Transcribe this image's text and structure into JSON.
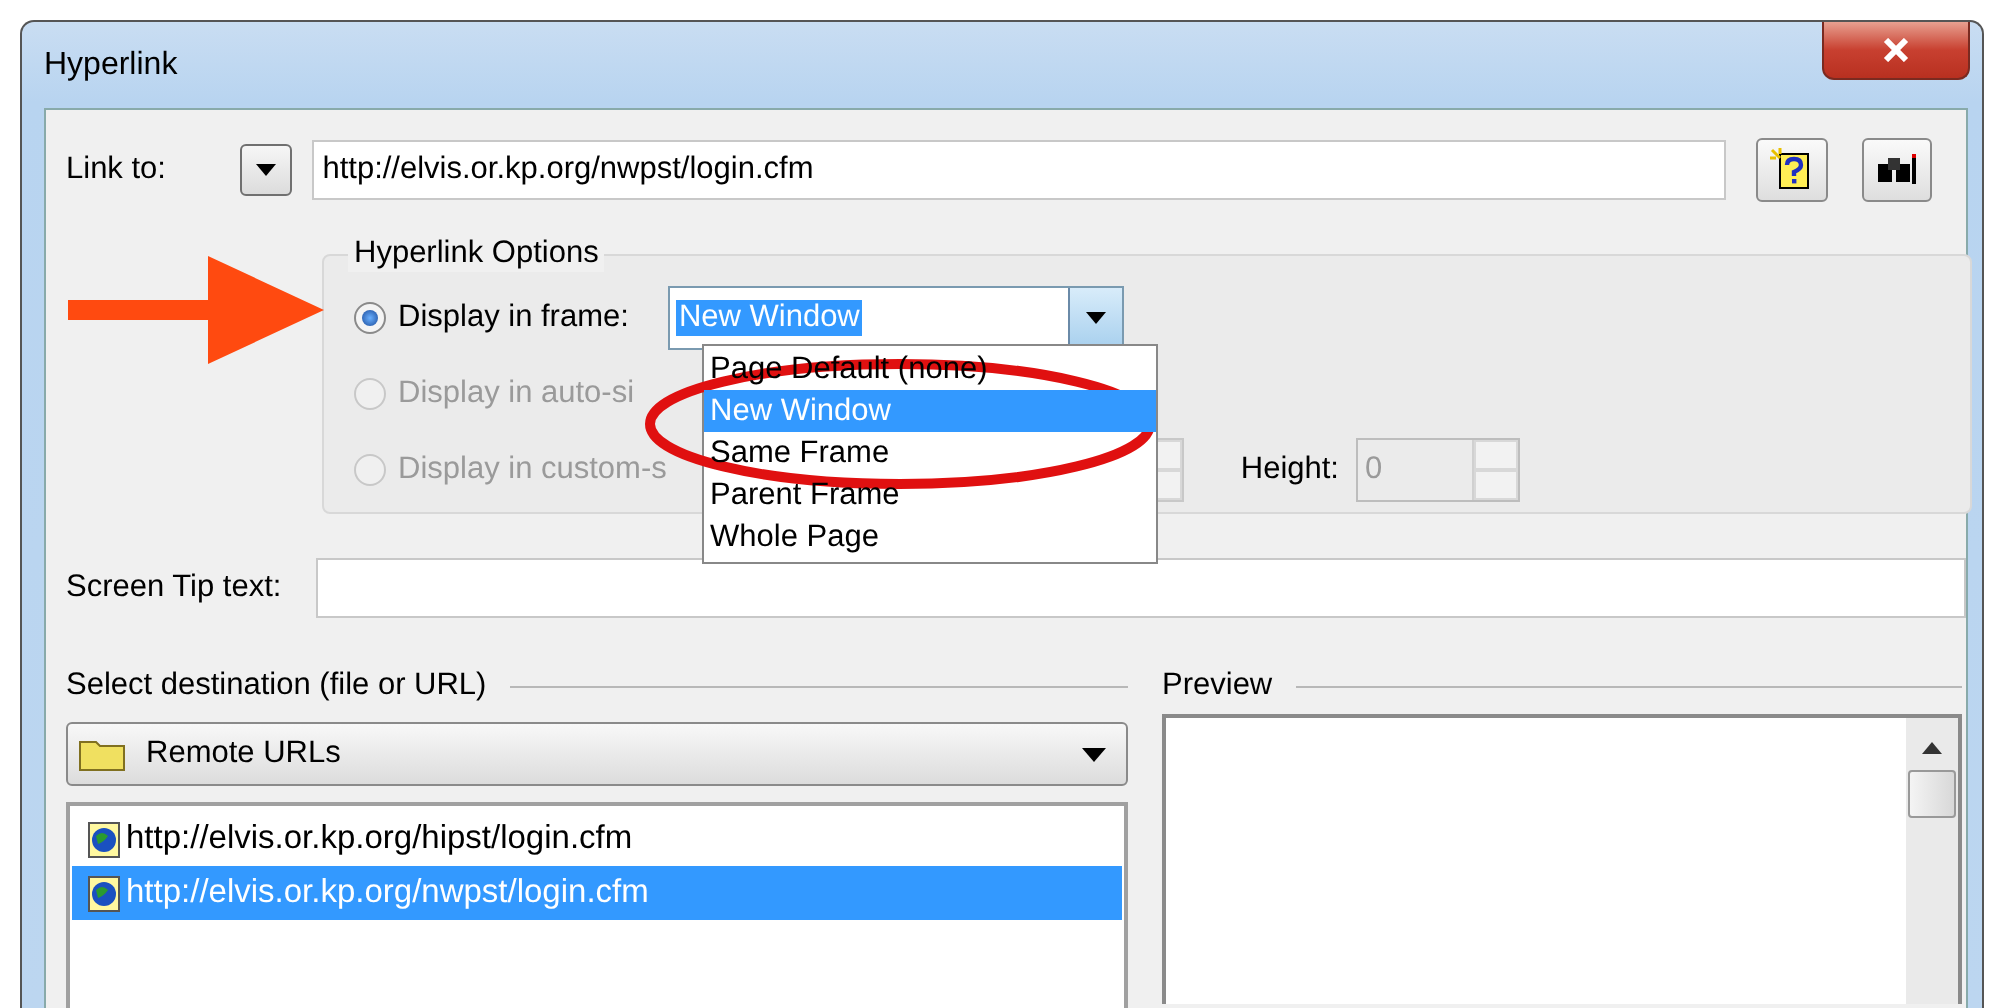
{
  "window": {
    "title": "Hyperlink"
  },
  "link_to": {
    "label": "Link to:",
    "value": "http://elvis.or.kp.org/nwpst/login.cfm"
  },
  "hyperlink_options": {
    "title": "Hyperlink Options",
    "options": [
      {
        "label": "Display in frame:",
        "selected": true,
        "disabled": false
      },
      {
        "label": "Display in auto-si",
        "selected": false,
        "disabled": true
      },
      {
        "label": "Display in custom-s",
        "selected": false,
        "disabled": true
      }
    ],
    "frame": {
      "value": "New Window",
      "options": [
        {
          "label": "Page Default (none)",
          "selected": false
        },
        {
          "label": "New Window",
          "selected": true
        },
        {
          "label": "Same Frame",
          "selected": false
        },
        {
          "label": "Parent Frame",
          "selected": false
        },
        {
          "label": "Whole Page",
          "selected": false
        }
      ]
    },
    "height": {
      "label": "Height:",
      "value": "0",
      "disabled": true
    }
  },
  "screen_tip": {
    "label": "Screen Tip text:"
  },
  "destination": {
    "label": "Select destination (file or URL)",
    "folder": "Remote URLs",
    "items": [
      {
        "label": "http://elvis.or.kp.org/hipst/login.cfm",
        "selected": false
      },
      {
        "label": "http://elvis.or.kp.org/nwpst/login.cfm",
        "selected": true
      }
    ]
  },
  "preview": {
    "label": "Preview"
  }
}
